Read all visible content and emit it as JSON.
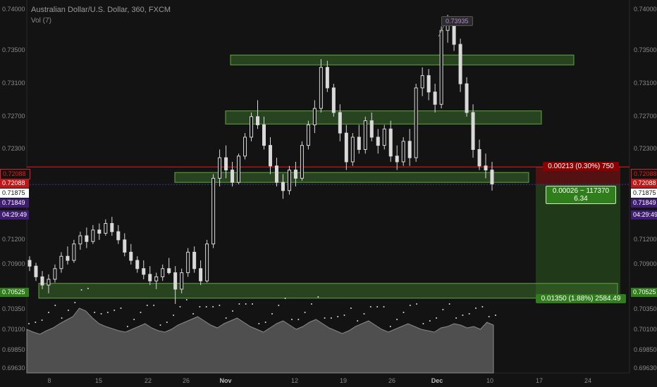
{
  "header": {
    "title": "Australian Dollar/U.S. Dollar, 360, FXCM",
    "indicator": "Vol (7)"
  },
  "colors": {
    "background": "#131313",
    "candle": "#d9d9d9",
    "zone_fill": "#3b6b2b",
    "zone_border": "#5fa83e",
    "red_line": "#e02020",
    "blue_line": "#3a3aa0",
    "purple_tag": "#3d1c72",
    "green_tag": "#2f7d1b",
    "red_tag": "#8b0000"
  },
  "price_axis": {
    "ticks": [
      "0.74000",
      "0.73500",
      "0.73100",
      "0.72700",
      "0.72300",
      "0.71200",
      "0.70900",
      "0.70350",
      "0.70100",
      "0.69850",
      "0.69630"
    ],
    "ticks_right": [
      "0.74000",
      "0.73500",
      "0.73100",
      "0.72700",
      "0.72300",
      "0.71200",
      "0.70900",
      "0.70350",
      "0.70100",
      "0.69850",
      "0.69630"
    ]
  },
  "price_tags": {
    "left": [
      {
        "text": "0.72088",
        "style": "red-outline"
      },
      {
        "text": "0.72088",
        "style": "red"
      },
      {
        "text": "0.71875",
        "style": "white"
      },
      {
        "text": "0.71849",
        "style": "purple"
      },
      {
        "text": "04:29:49",
        "style": "purple"
      },
      {
        "text": "0.70525",
        "style": "green"
      }
    ],
    "right": [
      {
        "text": "0.72088",
        "style": "red-outline"
      },
      {
        "text": "0.72088",
        "style": "red"
      },
      {
        "text": "0.71875",
        "style": "white"
      },
      {
        "text": "0.71849",
        "style": "purple"
      },
      {
        "text": "04:29:49",
        "style": "purple"
      },
      {
        "text": "0.70525",
        "style": "green"
      }
    ]
  },
  "time_axis": {
    "labels": [
      "8",
      "15",
      "22",
      "26",
      "Nov",
      "12",
      "19",
      "26",
      "Dec",
      "10",
      "17",
      "24"
    ]
  },
  "annotations": {
    "high_callout": "0.73935",
    "risk_label": "0.00213 (0.30%) 750",
    "position_label_line1": "0.00026 ~ 117370",
    "position_label_line2": "6.34",
    "target_label": "0.01350 (1.88%) 2584.49"
  },
  "chart_data": {
    "type": "candlestick",
    "series": [
      {
        "name": "Australian Dollar/U.S. Dollar",
        "values": [
          [
            0.7095,
            0.71,
            0.7082,
            0.7088
          ],
          [
            0.7088,
            0.7092,
            0.707,
            0.7075
          ],
          [
            0.7075,
            0.7082,
            0.706,
            0.7065
          ],
          [
            0.7065,
            0.7078,
            0.7055,
            0.7072
          ],
          [
            0.7072,
            0.709,
            0.7068,
            0.7085
          ],
          [
            0.7085,
            0.7105,
            0.708,
            0.71
          ],
          [
            0.71,
            0.7112,
            0.709,
            0.7095
          ],
          [
            0.7095,
            0.712,
            0.7092,
            0.7115
          ],
          [
            0.7115,
            0.713,
            0.7108,
            0.7125
          ],
          [
            0.7125,
            0.7135,
            0.711,
            0.7118
          ],
          [
            0.7118,
            0.7138,
            0.7115,
            0.7132
          ],
          [
            0.7132,
            0.714,
            0.712,
            0.7128
          ],
          [
            0.7128,
            0.7145,
            0.7125,
            0.714
          ],
          [
            0.714,
            0.7148,
            0.7125,
            0.713
          ],
          [
            0.713,
            0.7138,
            0.7115,
            0.712
          ],
          [
            0.712,
            0.7128,
            0.71,
            0.7105
          ],
          [
            0.7105,
            0.7115,
            0.709,
            0.7095
          ],
          [
            0.7095,
            0.71,
            0.708,
            0.7085
          ],
          [
            0.7085,
            0.7095,
            0.7072,
            0.7078
          ],
          [
            0.7078,
            0.7088,
            0.7065,
            0.707
          ],
          [
            0.707,
            0.708,
            0.706,
            0.7075
          ],
          [
            0.7075,
            0.709,
            0.707,
            0.7085
          ],
          [
            0.7085,
            0.7098,
            0.7078,
            0.708
          ],
          [
            0.708,
            0.7088,
            0.7042,
            0.706
          ],
          [
            0.706,
            0.7085,
            0.7055,
            0.708
          ],
          [
            0.708,
            0.711,
            0.7075,
            0.7105
          ],
          [
            0.7105,
            0.7112,
            0.708,
            0.7085
          ],
          [
            0.7085,
            0.7095,
            0.7065,
            0.707
          ],
          [
            0.707,
            0.712,
            0.7068,
            0.7115
          ],
          [
            0.7115,
            0.72,
            0.711,
            0.7195
          ],
          [
            0.7195,
            0.723,
            0.7185,
            0.722
          ],
          [
            0.722,
            0.7235,
            0.7195,
            0.7205
          ],
          [
            0.7205,
            0.7215,
            0.7185,
            0.719
          ],
          [
            0.719,
            0.7225,
            0.7188,
            0.7222
          ],
          [
            0.7222,
            0.725,
            0.7218,
            0.7245
          ],
          [
            0.7245,
            0.7275,
            0.724,
            0.727
          ],
          [
            0.727,
            0.729,
            0.7255,
            0.726
          ],
          [
            0.726,
            0.727,
            0.723,
            0.7235
          ],
          [
            0.7235,
            0.7245,
            0.72,
            0.721
          ],
          [
            0.721,
            0.722,
            0.7185,
            0.719
          ],
          [
            0.719,
            0.72,
            0.717,
            0.718
          ],
          [
            0.718,
            0.721,
            0.7175,
            0.7205
          ],
          [
            0.7205,
            0.7215,
            0.7185,
            0.7195
          ],
          [
            0.7195,
            0.724,
            0.7192,
            0.7235
          ],
          [
            0.7235,
            0.7265,
            0.723,
            0.726
          ],
          [
            0.726,
            0.729,
            0.725,
            0.728
          ],
          [
            0.728,
            0.734,
            0.7275,
            0.733
          ],
          [
            0.733,
            0.7338,
            0.73,
            0.7305
          ],
          [
            0.7305,
            0.731,
            0.727,
            0.7275
          ],
          [
            0.7275,
            0.7285,
            0.724,
            0.725
          ],
          [
            0.725,
            0.726,
            0.7205,
            0.7215
          ],
          [
            0.7215,
            0.725,
            0.721,
            0.7245
          ],
          [
            0.7245,
            0.726,
            0.7225,
            0.723
          ],
          [
            0.723,
            0.727,
            0.7225,
            0.7265
          ],
          [
            0.7265,
            0.7275,
            0.724,
            0.7245
          ],
          [
            0.7245,
            0.7255,
            0.7225,
            0.7235
          ],
          [
            0.7235,
            0.726,
            0.723,
            0.7255
          ],
          [
            0.7255,
            0.7265,
            0.7215,
            0.7222
          ],
          [
            0.7222,
            0.7235,
            0.7205,
            0.7215
          ],
          [
            0.7215,
            0.7245,
            0.721,
            0.724
          ],
          [
            0.724,
            0.7255,
            0.721,
            0.722
          ],
          [
            0.722,
            0.731,
            0.7215,
            0.7305
          ],
          [
            0.7305,
            0.733,
            0.7295,
            0.732
          ],
          [
            0.732,
            0.7328,
            0.729,
            0.73
          ],
          [
            0.73,
            0.731,
            0.7275,
            0.7285
          ],
          [
            0.7285,
            0.738,
            0.728,
            0.7375
          ],
          [
            0.7375,
            0.7394,
            0.736,
            0.7385
          ],
          [
            0.7385,
            0.7392,
            0.735,
            0.7358
          ],
          [
            0.7358,
            0.7365,
            0.73,
            0.731
          ],
          [
            0.731,
            0.7318,
            0.727,
            0.7275
          ],
          [
            0.7275,
            0.7285,
            0.722,
            0.723
          ],
          [
            0.723,
            0.7242,
            0.7205,
            0.721
          ],
          [
            0.721,
            0.7225,
            0.7195,
            0.7205
          ],
          [
            0.7205,
            0.7215,
            0.718,
            0.7188
          ]
        ]
      }
    ],
    "volume": [
      62,
      58,
      55,
      60,
      64,
      70,
      75,
      80,
      92,
      88,
      78,
      70,
      66,
      63,
      60,
      58,
      62,
      66,
      70,
      64,
      60,
      58,
      62,
      68,
      72,
      76,
      80,
      74,
      68,
      64,
      70,
      74,
      78,
      72,
      66,
      62,
      58,
      64,
      70,
      74,
      68,
      62,
      66,
      72,
      76,
      70,
      64,
      60,
      56,
      60,
      66,
      70,
      74,
      68,
      62,
      58,
      62,
      66,
      70,
      66,
      62,
      60,
      58,
      64,
      66,
      70,
      68,
      64,
      66,
      62,
      72,
      68
    ],
    "ylim": [
      0.6958,
      0.7412
    ],
    "support_resistance_zones": [
      [
        0.7333,
        0.7345
      ],
      [
        0.7261,
        0.7277
      ],
      [
        0.719,
        0.7202
      ],
      [
        0.7049,
        0.7067
      ]
    ],
    "horizontal_lines": {
      "stop": 0.72088,
      "current": 0.71875
    },
    "position": {
      "entry": 0.71875,
      "stop": 0.72088,
      "target": 0.70525
    },
    "grid": false
  }
}
